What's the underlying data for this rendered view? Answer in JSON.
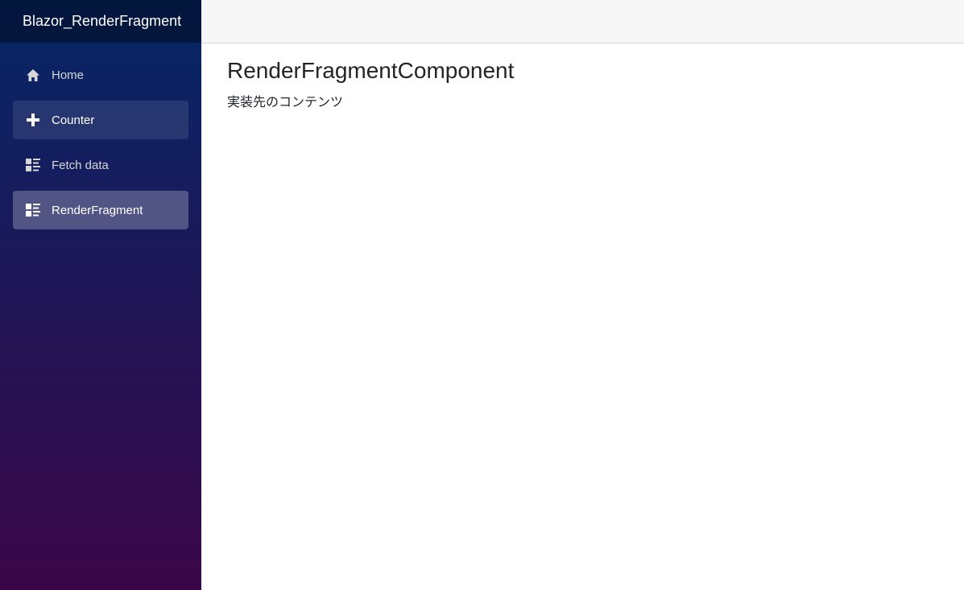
{
  "sidebar": {
    "brand": "Blazor_RenderFragment",
    "items": [
      {
        "label": "Home",
        "icon": "home-icon",
        "state": "normal"
      },
      {
        "label": "Counter",
        "icon": "plus-icon",
        "state": "hovered"
      },
      {
        "label": "Fetch data",
        "icon": "list-icon",
        "state": "normal"
      },
      {
        "label": "RenderFragment",
        "icon": "list-icon",
        "state": "active"
      }
    ],
    "gradient_top": "#052767",
    "gradient_bottom": "#3a0647"
  },
  "main": {
    "title": "RenderFragmentComponent",
    "text": "実装先のコンテンツ"
  }
}
